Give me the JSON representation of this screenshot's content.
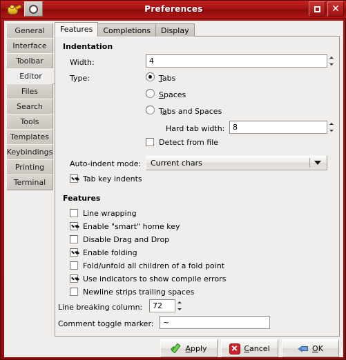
{
  "window": {
    "title": "Preferences",
    "icons": {
      "app": "lamp-icon",
      "menu": "window-menu-icon",
      "maximize": "maximize-icon",
      "close": "close-icon"
    }
  },
  "sidebar": {
    "items": [
      {
        "label": "General",
        "selected": false
      },
      {
        "label": "Interface",
        "selected": false
      },
      {
        "label": "Toolbar",
        "selected": false
      },
      {
        "label": "Editor",
        "selected": true
      },
      {
        "label": "Files",
        "selected": false
      },
      {
        "label": "Search",
        "selected": false
      },
      {
        "label": "Tools",
        "selected": false
      },
      {
        "label": "Templates",
        "selected": false
      },
      {
        "label": "Keybindings",
        "selected": false
      },
      {
        "label": "Printing",
        "selected": false
      },
      {
        "label": "Terminal",
        "selected": false
      }
    ]
  },
  "tabs": [
    {
      "label": "Features",
      "active": true
    },
    {
      "label": "Completions",
      "active": false
    },
    {
      "label": "Display",
      "active": false
    }
  ],
  "indentation": {
    "heading": "Indentation",
    "width_label": "Width:",
    "width_value": "4",
    "type_label": "Type:",
    "radios": [
      {
        "label_pre": "",
        "label_mn": "T",
        "label_post": "abs",
        "checked": true
      },
      {
        "label_pre": "",
        "label_mn": "S",
        "label_post": "paces",
        "checked": false
      },
      {
        "label_pre": "T",
        "label_mn": "a",
        "label_post": "bs and Spaces",
        "checked": false
      }
    ],
    "hard_tab_label": "Hard tab width:",
    "hard_tab_value": "8",
    "detect_label": "Detect from file",
    "detect_checked": false,
    "auto_indent_label": "Auto-indent mode:",
    "auto_indent_value": "Current chars",
    "tab_key_label": "Tab key indents",
    "tab_key_checked": true
  },
  "features": {
    "heading": "Features",
    "checkboxes": [
      {
        "label": "Line wrapping",
        "checked": false
      },
      {
        "label": "Enable \"smart\" home key",
        "checked": true
      },
      {
        "label": "Disable Drag and Drop",
        "checked": false
      },
      {
        "label": "Enable folding",
        "checked": true
      },
      {
        "label": "Fold/unfold all children of a fold point",
        "checked": false
      },
      {
        "label": "Use indicators to show compile errors",
        "checked": true
      },
      {
        "label": "Newline strips trailing spaces",
        "checked": false
      }
    ],
    "line_break_label": "Line breaking column:",
    "line_break_value": "72",
    "comment_label": "Comment toggle marker:",
    "comment_value": "~"
  },
  "actions": [
    {
      "label_pre": "",
      "label_mn": "A",
      "label_post": "pply",
      "icon": "check-icon"
    },
    {
      "label_pre": "",
      "label_mn": "C",
      "label_post": "ancel",
      "icon": "cancel-icon"
    },
    {
      "label_pre": "",
      "label_mn": "O",
      "label_post": "K",
      "icon": "ok-arrow-icon"
    }
  ]
}
